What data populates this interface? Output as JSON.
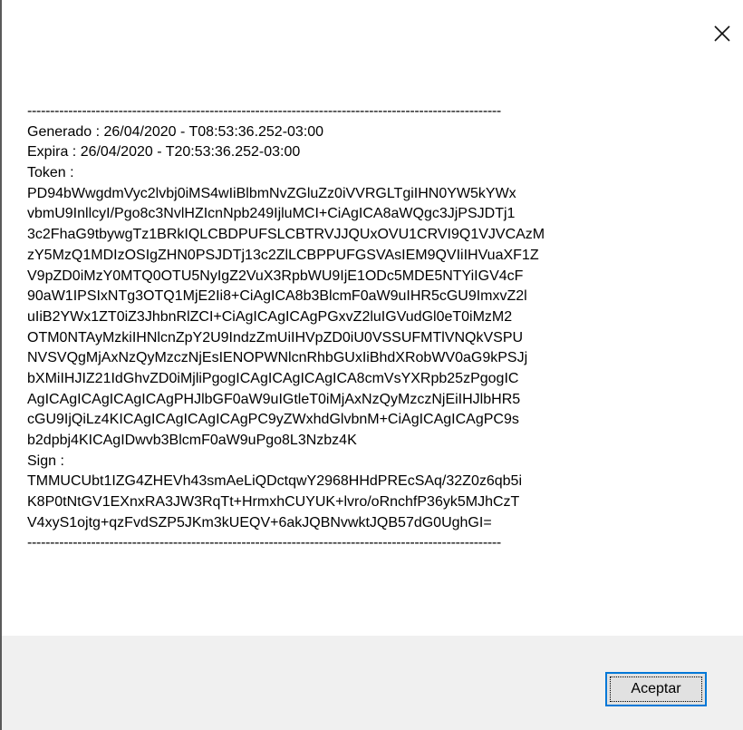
{
  "window": {
    "close_icon": "close-icon"
  },
  "message": {
    "divider_top": "--------------------------------------------------------------------------------------------------------",
    "generated": "Generado : 26/04/2020 - T08:53:36.252-03:00",
    "expires": "Expira : 26/04/2020 - T20:53:36.252-03:00",
    "token_label": "Token :",
    "token_lines": [
      "PD94bWwgdmVyc2lvbj0iMS4wIiBlbmNvZGluZz0iVVRGLTgiIHN0YW5kYWx",
      "vbmU9InllcyI/Pgo8c3NvlHZIcnNpb249IjluMCI+CiAgICA8aWQgc3JjPSJDTj1",
      "3c2FhaG9tbywgTz1BRkIQLCBDPUFSLCBTRVJJQUxOVU1CRVI9Q1VJVCAzM",
      "zY5MzQ1MDIzOSIgZHN0PSJDTj13c2ZlLCBPPUFGSVAsIEM9QVIiIHVuaXF1Z",
      "V9pZD0iMzY0MTQ0OTU5NyIgZ2VuX3RpbWU9IjE1ODc5MDE5NTYiIGV4cF",
      "90aW1IPSIxNTg3OTQ1MjE2Ii8+CiAgICA8b3BlcmF0aW9uIHR5cGU9ImxvZ2l",
      "uIiB2YWx1ZT0iZ3JhbnRlZCI+CiAgICAgICAgPGxvZ2luIGVudGl0eT0iMzM2",
      "OTM0NTAyMzkiIHNlcnZpY2U9IndzZmUiIHVpZD0iU0VSSUFMTlVNQkVSPU",
      "NVSVQgMjAxNzQyMzczNjEsIENOPWNlcnRhbGUxIiBhdXRobWV0aG9kPSJj",
      "bXMiIHJIZ21IdGhvZD0iMjliPgogICAgICAgICAgICA8cmVsYXRpb25zPgogIC",
      "AgICAgICAgICAgICAgPHJlbGF0aW9uIGtleT0iMjAxNzQyMzczNjEiIHJlbHR5",
      "cGU9IjQiLz4KICAgICAgICAgICAgPC9yZWxhdGlvbnM+CiAgICAgICAgPC9s",
      "b2dpbj4KICAgIDwvb3BlcmF0aW9uPgo8L3Nzbz4K"
    ],
    "sign_label": "Sign :",
    "sign_lines": [
      "TMMUCUbt1IZG4ZHEVh43smAeLiQDctqwY2968HHdPREcSAq/32Z0z6qb5i",
      "K8P0tNtGV1EXnxRA3JW3RqTt+HrmxhCUYUK+lvro/oRnchfP36yk5MJhCzT",
      "V4xyS1ojtg+qzFvdSZP5JKm3kUEQV+6akJQBNvwktJQB57dG0UghGI="
    ],
    "divider_bottom": "--------------------------------------------------------------------------------------------------------"
  },
  "footer": {
    "accept_label": "Aceptar"
  },
  "colors": {
    "footer_bg": "#f0f0f0",
    "button_bg": "#e1e1e1",
    "focus_border": "#0078d7"
  }
}
